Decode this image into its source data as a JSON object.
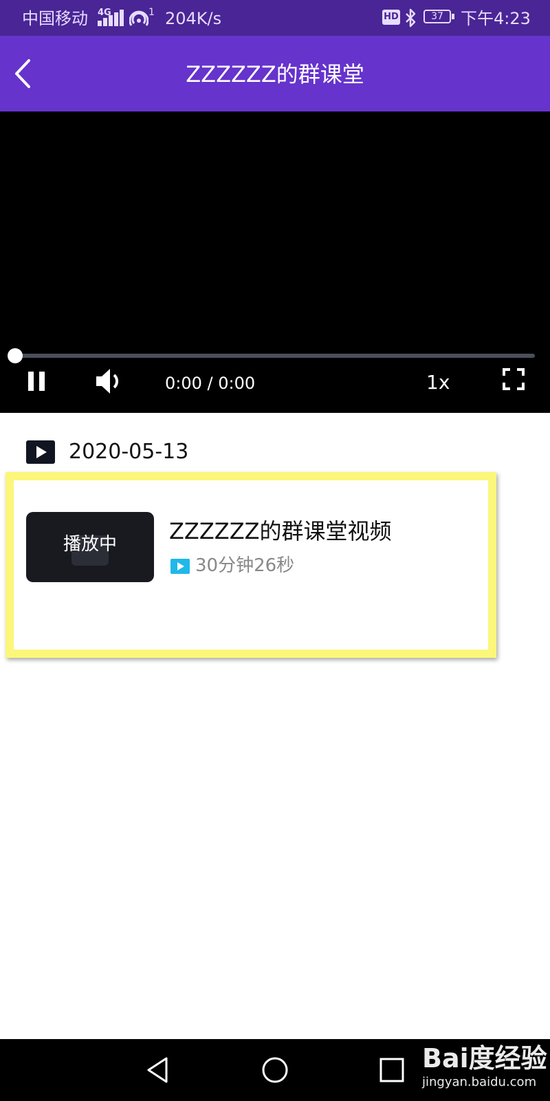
{
  "status_bar": {
    "carrier": "中国移动",
    "network_type": "4G",
    "hotspot_count": "1",
    "net_speed": "204K/s",
    "hd_badge": "HD",
    "battery": "37",
    "time": "下午4:23",
    "icons": [
      "signal-icon",
      "hotspot-icon",
      "hd-icon",
      "bluetooth-icon",
      "battery-icon"
    ]
  },
  "header": {
    "title": "ZZZZZZ的群课堂",
    "back_icon": "chevron-left-icon",
    "background_color": "#6633cc"
  },
  "player": {
    "progress": 0,
    "time_display": "0:00 / 0:00",
    "speed": "1x",
    "icons": [
      "pause-icon",
      "volume-icon",
      "fullscreen-icon"
    ]
  },
  "list": {
    "date": "2020-05-13",
    "date_icon": "play-square-icon",
    "items": [
      {
        "status": "播放中",
        "title": "ZZZZZZ的群课堂视频",
        "duration": "30分钟26秒",
        "duration_icon": "play-icon",
        "duration_icon_color": "#20b8e8"
      }
    ]
  },
  "nav_bar": {
    "icons": [
      "back-triangle-icon",
      "home-circle-icon",
      "recents-square-icon"
    ]
  },
  "watermark": {
    "logo": "Bai度经验",
    "url": "jingyan.baidu.com"
  }
}
